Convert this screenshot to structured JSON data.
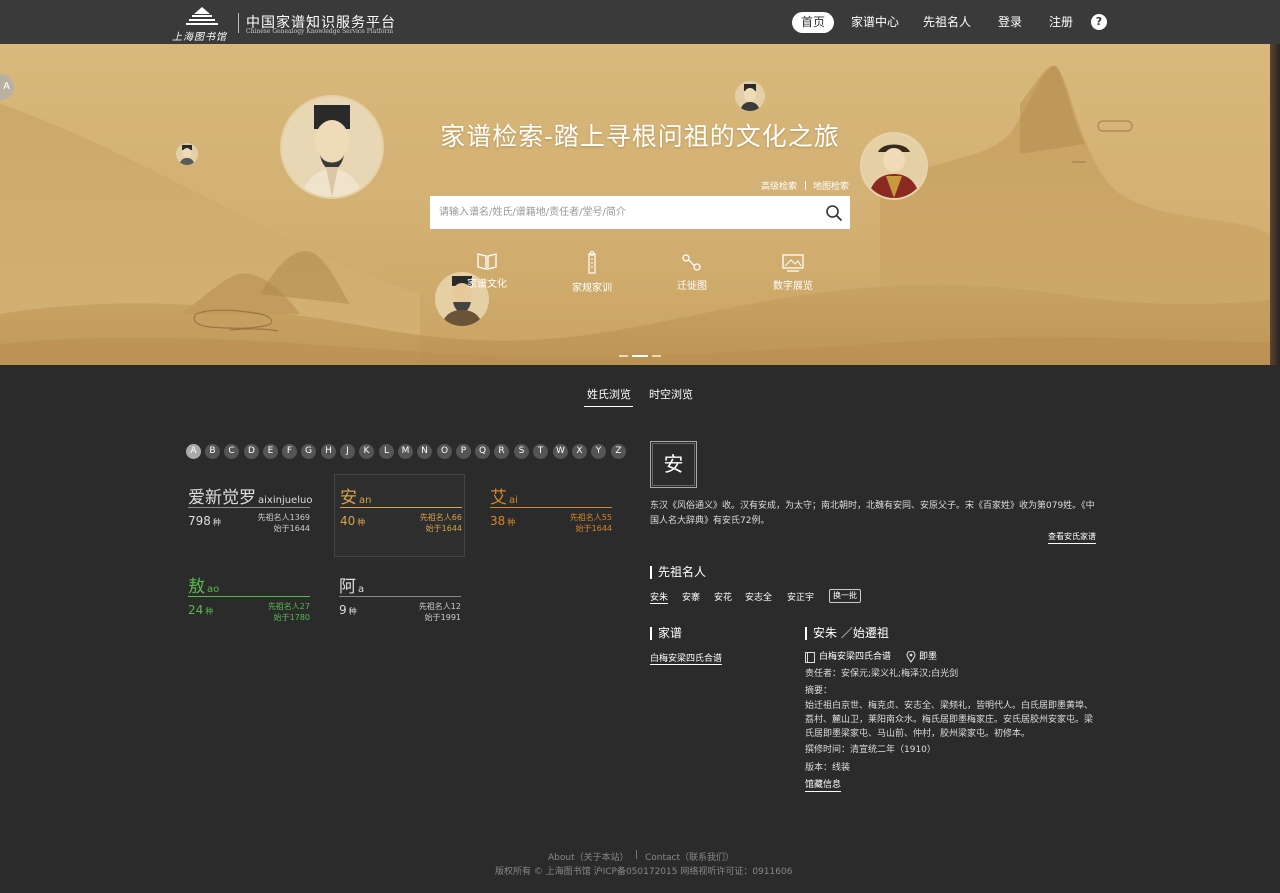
{
  "header": {
    "logo_text": "上海图书馆",
    "site_title": "中国家谱知识服务平台",
    "site_subtitle": "Chinese Genealogy Knowledge Service Platform",
    "nav": [
      {
        "label": "首页"
      },
      {
        "label": "家谱中心"
      },
      {
        "label": "先祖名人"
      },
      {
        "label": "登录"
      },
      {
        "label": "注册"
      }
    ],
    "help_label": "?"
  },
  "hero": {
    "side_tab": "A",
    "title": "家谱检索-踏上寻根问祖的文化之旅",
    "advanced_search": "高级检索",
    "map_search": "地图检索",
    "search_placeholder": "请输入谱名/姓氏/谱籍地/责任者/堂号/简介",
    "quick_links": [
      {
        "label": "家谱文化",
        "icon": "book-open-icon"
      },
      {
        "label": "家规家训",
        "icon": "scroll-icon"
      },
      {
        "label": "迁徙图",
        "icon": "route-icon"
      },
      {
        "label": "数字展览",
        "icon": "exhibition-icon"
      }
    ],
    "carousel_active": 1
  },
  "browse_tabs": [
    {
      "label": "姓氏浏览"
    },
    {
      "label": "时空浏览"
    }
  ],
  "letters": [
    "A",
    "B",
    "C",
    "D",
    "E",
    "F",
    "G",
    "H",
    "J",
    "K",
    "L",
    "M",
    "N",
    "O",
    "P",
    "Q",
    "R",
    "S",
    "T",
    "W",
    "X",
    "Y",
    "Z"
  ],
  "selected_letter": "A",
  "surnames": [
    {
      "name": "爱新觉罗",
      "pinyin": "aixinjueluo",
      "count": "798",
      "unit": "种",
      "famous": "先祖名人1369",
      "since": "始于1644",
      "color": "#dddddd"
    },
    {
      "name": "安",
      "pinyin": "an",
      "count": "40",
      "unit": "种",
      "famous": "先祖名人66",
      "since": "始于1644",
      "color": "#d6a24a"
    },
    {
      "name": "艾",
      "pinyin": "ai",
      "count": "38",
      "unit": "种",
      "famous": "先祖名人55",
      "since": "始于1644",
      "color": "#d8862a"
    },
    {
      "name": "敖",
      "pinyin": "ao",
      "count": "24",
      "unit": "种",
      "famous": "先祖名人27",
      "since": "始于1780",
      "color": "#58b94f"
    },
    {
      "name": "阿",
      "pinyin": "a",
      "count": "9",
      "unit": "种",
      "famous": "先祖名人12",
      "since": "始于1991",
      "color": "#dddddd"
    }
  ],
  "detail": {
    "character": "安",
    "description": "东汉《风俗通义》收。汉有安成，为太守；南北朝时，北魏有安同、安原父子。宋《百家姓》收为第079姓。《中国人名大辞典》有安氏72例。",
    "more_link": "查看安氏家谱",
    "ancestors_title": "先祖名人",
    "ancestors": [
      "安朱",
      "安寨",
      "安花",
      "安志全",
      "安正宇"
    ],
    "swap_label": "换一批",
    "jiapu_title": "家谱",
    "jiapu_link": "白梅安梁四氏合谱",
    "founder_title": "安朱 ／始遷祖",
    "book_name": "白梅安梁四氏合谱",
    "place": "即墨",
    "responsible": "责任者：安保元;梁义礼;梅泽汉;白光剑",
    "abstract_label": "摘要：",
    "abstract": "始迁祖白京世、梅克贞、安志全、梁频礼，皆明代人。白氏居即墨黄埠、荔村、麓山卫，莱阳南众水。梅氏居即墨梅家庄。安氏居胶州安家屯。梁氏居即墨梁家屯、马山前、仲村，胶州梁家屯。初修本。",
    "time": "撰修时间：清宣统二年（1910）",
    "edition": "版本：线装",
    "holding_link": "馆藏信息"
  },
  "footer": {
    "about": "About（关于本站）",
    "contact": "Contact（联系我们）",
    "separator": "|",
    "copyright": "版权所有 © 上海图书馆 沪ICP备050172015 网络视听许可证：0911606"
  }
}
